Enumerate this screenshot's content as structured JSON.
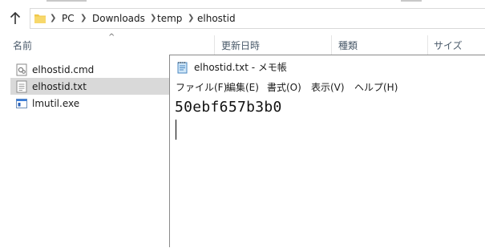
{
  "explorer": {
    "breadcrumb": [
      "PC",
      "Downloads",
      "temp",
      "elhostid"
    ],
    "columns": {
      "name": "名前",
      "modified": "更新日時",
      "type": "種類",
      "size": "サイズ"
    },
    "files": [
      {
        "name": "elhostid.cmd",
        "icon": "cmd-file-icon",
        "selected": false
      },
      {
        "name": "elhostid.txt",
        "icon": "text-file-icon",
        "selected": true
      },
      {
        "name": "lmutil.exe",
        "icon": "exe-file-icon",
        "selected": false
      }
    ]
  },
  "notepad": {
    "title": "elhostid.txt - メモ帳",
    "menu": [
      "ファイル(F)",
      "編集(E)",
      "書式(O)",
      "表示(V)",
      "ヘルプ(H)"
    ],
    "content": "50ebf657b3b0"
  },
  "colors": {
    "selection": "#d9d9d9",
    "header_text": "#4a5a6a",
    "folder": "#f0c84a"
  }
}
